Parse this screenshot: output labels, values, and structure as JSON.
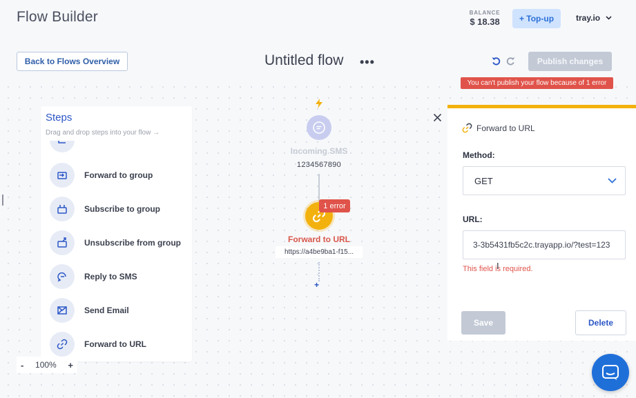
{
  "header": {
    "app_title": "Flow Builder",
    "balance_label": "BALANCE",
    "balance_value": "$ 18.38",
    "topup_label": "+ Top-up",
    "account_name": "tray.io"
  },
  "toolbar": {
    "back_label": "Back to Flows Overview",
    "flow_title": "Untitled flow",
    "menu_glyph": "•••",
    "publish_label": "Publish changes",
    "publish_error": "You can't publish your flow because of 1 error"
  },
  "steps_panel": {
    "title": "Steps",
    "subtitle": "Drag and drop steps into your flow →",
    "items": [
      {
        "label": "",
        "icon": "partial-step-icon"
      },
      {
        "label": "Forward to group",
        "icon": "forward-group-icon"
      },
      {
        "label": "Subscribe to group",
        "icon": "subscribe-group-icon"
      },
      {
        "label": "Unsubscribe from group",
        "icon": "unsubscribe-group-icon"
      },
      {
        "label": "Reply to SMS",
        "icon": "reply-sms-icon"
      },
      {
        "label": "Send Email",
        "icon": "send-email-icon"
      },
      {
        "label": "Forward to URL",
        "icon": "link-icon"
      }
    ]
  },
  "zoom": {
    "minus": "-",
    "level": "100%",
    "plus": "+"
  },
  "canvas": {
    "trigger_label": "Incoming SMS",
    "trigger_sub": "1234567890",
    "step_label": "Forward to URL",
    "step_sub": "https://a4be9ba1-f15...",
    "error_badge": "1 error",
    "add_step": "+"
  },
  "properties": {
    "title": "Forward to URL",
    "method_label": "Method:",
    "method_value": "GET",
    "url_label": "URL:",
    "url_value": "3-3b5431fb5c2c.trayapp.io/?test=123",
    "url_error": "This field is required.",
    "save_label": "Save",
    "delete_label": "Delete"
  },
  "colors": {
    "accent_blue": "#2b56c6",
    "error_red": "#e0534a",
    "warning_yellow": "#f3b10d",
    "disabled_grey": "#c3cad6",
    "chat_blue": "#1f6fd9"
  }
}
